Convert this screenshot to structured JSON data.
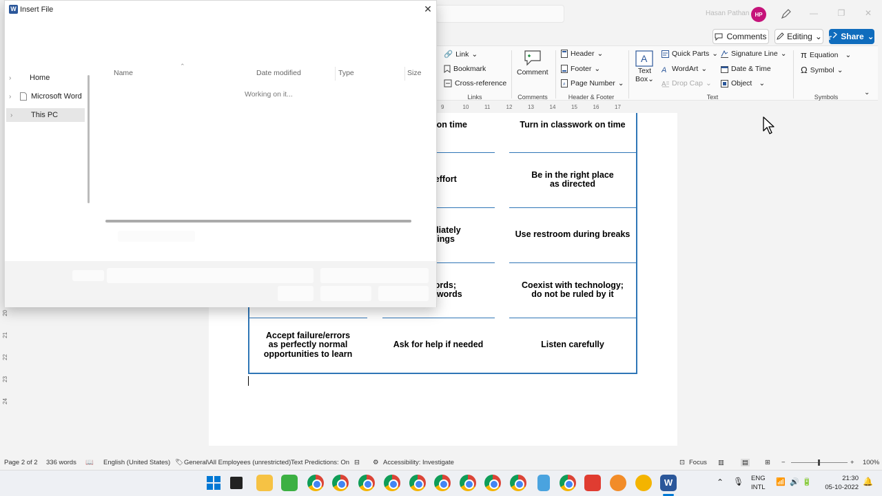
{
  "window": {
    "user_name": "Hasan Pathan",
    "user_initials": "HP",
    "comments_label": "Comments",
    "editing_label": "Editing",
    "share_label": "Share"
  },
  "ribbon": {
    "links": {
      "link": "Link",
      "bookmark": "Bookmark",
      "cross_reference": "Cross-reference",
      "group": "Links"
    },
    "comments": {
      "comment": "Comment",
      "group": "Comments"
    },
    "header_footer": {
      "header": "Header",
      "footer": "Footer",
      "page_number": "Page Number",
      "group": "Header & Footer"
    },
    "text": {
      "text_box_line1": "Text",
      "text_box_line2": "Box",
      "quick_parts": "Quick Parts",
      "wordart": "WordArt",
      "drop_cap": "Drop Cap",
      "signature_line": "Signature Line",
      "date_time": "Date & Time",
      "object": "Object",
      "group": "Text"
    },
    "symbols": {
      "equation": "Equation",
      "symbol": "Symbol",
      "group": "Symbols"
    }
  },
  "ruler": {
    "marks": [
      "9",
      "10",
      "11",
      "12",
      "13",
      "14",
      "15",
      "16",
      "17"
    ],
    "vmarks": [
      "20",
      "21",
      "22",
      "23",
      "24"
    ]
  },
  "table": {
    "cells": [
      [
        "ework on time",
        "Turn in classwork on time"
      ],
      [
        "est effort",
        "Be in the right place\nas directed"
      ],
      [
        "nmediately\nell rings",
        "Use restroom during breaks"
      ],
      [
        "d words;\nnean words",
        "Coexist with technology;\ndo not be ruled by it"
      ]
    ],
    "last_row": [
      "Accept failure/errors\nas perfectly normal\nopportunities to learn",
      "Ask for help if needed",
      "Listen carefully"
    ]
  },
  "dialog": {
    "title": "Insert File",
    "nav": [
      "Home",
      "Microsoft Word",
      "This PC"
    ],
    "columns": {
      "name": "Name",
      "date_modified": "Date modified",
      "type": "Type",
      "size": "Size"
    },
    "status": "Working on it..."
  },
  "statusbar": {
    "page": "Page 2 of 2",
    "words": "336 words",
    "language": "English (United States)",
    "sensitivity": "General\\All Employees (unrestricted)",
    "predictions": "Text Predictions: On",
    "accessibility": "Accessibility: Investigate",
    "focus": "Focus",
    "zoom": "100%"
  },
  "taskbar": {
    "lang_line1": "ENG",
    "lang_line2": "INTL",
    "time": "21:30",
    "date": "05-10-2022"
  }
}
